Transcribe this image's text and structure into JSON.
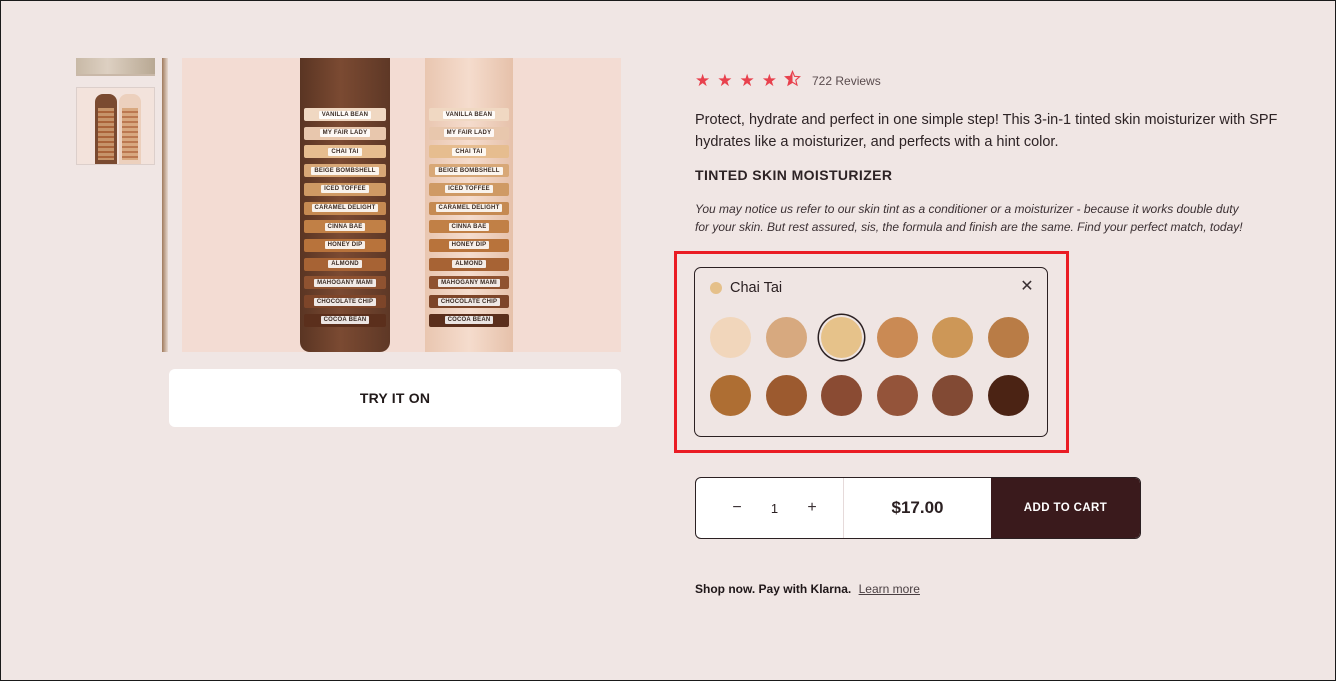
{
  "gallery": {
    "try_on_label": "TRY IT ON",
    "shade_labels_dark": [
      "VANILLA BEAN",
      "MY FAIR LADY",
      "CHAI TAI",
      "BEIGE BOMBSHELL",
      "ICED TOFFEE",
      "CARAMEL DELIGHT",
      "CINNA BAE",
      "HONEY DIP",
      "ALMOND",
      "MAHOGANY MAMI",
      "CHOCOLATE CHIP",
      "COCOA BEAN"
    ],
    "shade_labels_light": [
      "VANILLA BEAN",
      "MY FAIR LADY",
      "CHAI TAI",
      "BEIGE BOMBSHELL",
      "ICED TOFFEE",
      "CARAMEL DELIGHT",
      "CINNA BAE",
      "HONEY DIP",
      "ALMOND",
      "MAHOGANY MAMI",
      "CHOCOLATE CHIP",
      "COCOA BEAN"
    ]
  },
  "rating": {
    "stars": 4.5,
    "reviews_label": "722 Reviews"
  },
  "product": {
    "description": "Protect, hydrate and perfect in one simple step! This 3-in-1 tinted skin moisturizer with SPF hydrates like a moisturizer, and perfects with a hint color.",
    "subhead": "TINTED SKIN MOISTURIZER",
    "note": "You may notice us refer to our skin tint as a conditioner or a moisturizer - because it works double duty for your skin. But rest assured, sis, the formula and finish are the same. Find your perfect match, today!"
  },
  "shade_picker": {
    "selected_name": "Chai Tai",
    "selected_color": "#e5c08a",
    "close_icon": "close-icon",
    "swatch_colors": [
      "#f1d6bb",
      "#d7a97f",
      "#e6c28a",
      "#ca8a54",
      "#cd9757",
      "#b97c46",
      "#ae6e33",
      "#9c5a2f",
      "#8a4b33",
      "#94543a",
      "#824a34",
      "#4b2314"
    ],
    "selected_index": 2
  },
  "cart": {
    "minus_label": "−",
    "plus_label": "+",
    "quantity": "1",
    "price": "$17.00",
    "add_label": "ADD TO CART"
  },
  "klarna": {
    "text": "Shop now. Pay with Klarna.",
    "link": "Learn more"
  },
  "colors": {
    "accent_star": "#e8414d",
    "add_to_cart_bg": "#3a1a1c",
    "highlight_border": "#ea1c24"
  }
}
